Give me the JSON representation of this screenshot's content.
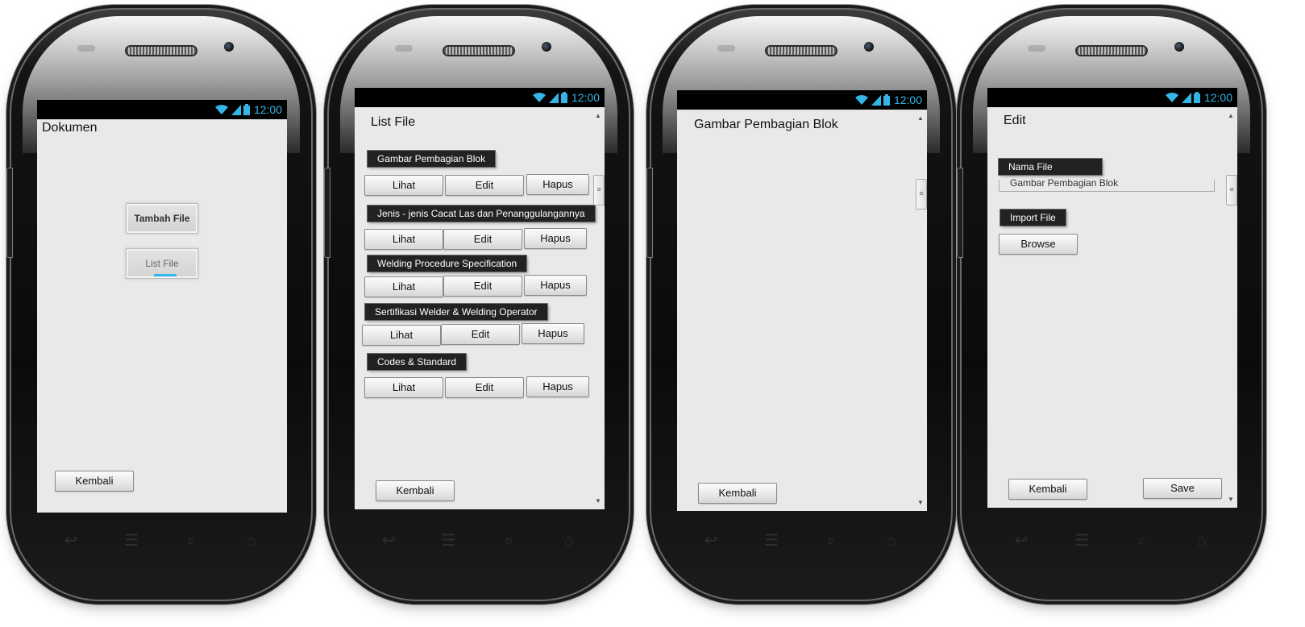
{
  "status": {
    "time": "12:00",
    "accent": "#33b5e5"
  },
  "screen1": {
    "title": "Dokumen",
    "add_button": "Tambah File",
    "list_button": "List File",
    "back_button": "Kembali"
  },
  "screen2": {
    "title": "List File",
    "items": [
      {
        "label": "Gambar Pembagian Blok"
      },
      {
        "label": "Jenis - jenis Cacat Las dan Penanggulangannya"
      },
      {
        "label": "Welding Procedure Specification"
      },
      {
        "label": "Sertifikasi Welder & Welding Operator"
      },
      {
        "label": "Codes & Standard"
      }
    ],
    "view_label": "Lihat",
    "edit_label": "Edit",
    "delete_label": "Hapus",
    "back_button": "Kembali"
  },
  "screen3": {
    "title": "Gambar Pembagian Blok",
    "back_button": "Kembali"
  },
  "screen4": {
    "title": "Edit",
    "name_label": "Nama File",
    "name_value": "Gambar Pembagian Blok",
    "import_label": "Import File",
    "browse_button": "Browse",
    "back_button": "Kembali",
    "save_button": "Save"
  },
  "icons": {
    "wifi": "wifi-icon",
    "signal": "signal-icon",
    "battery": "battery-icon",
    "back": "back-icon",
    "menu": "menu-icon",
    "search": "search-icon",
    "home": "home-icon",
    "scroll_up": "scroll-up-icon",
    "scroll_down": "scroll-down-icon"
  }
}
